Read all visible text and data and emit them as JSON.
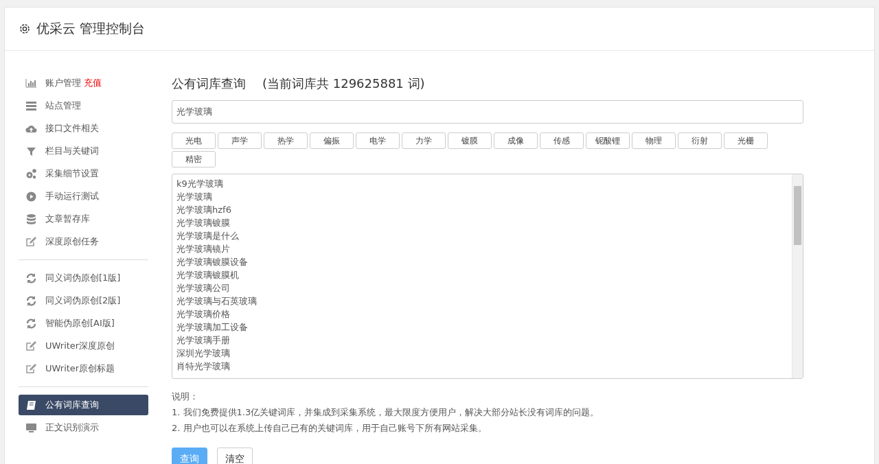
{
  "header": {
    "title": "优采云 管理控制台"
  },
  "sidebar": {
    "groups": [
      [
        {
          "kind": "chart",
          "label": "账户管理",
          "badge": "充值",
          "selected": false
        },
        {
          "kind": "server",
          "label": "站点管理",
          "selected": false
        },
        {
          "kind": "cloud",
          "label": "接口文件相关",
          "selected": false
        },
        {
          "kind": "filter",
          "label": "栏目与关键词",
          "selected": false
        },
        {
          "kind": "gears",
          "label": "采集细节设置",
          "selected": false
        },
        {
          "kind": "play",
          "label": "手动运行测试",
          "selected": false
        },
        {
          "kind": "database",
          "label": "文章暂存库",
          "selected": false
        },
        {
          "kind": "edit",
          "label": "深度原创任务",
          "selected": false
        }
      ],
      [
        {
          "kind": "refresh",
          "label": "同义词伪原创[1版]",
          "selected": false
        },
        {
          "kind": "refresh",
          "label": "同义词伪原创[2版]",
          "selected": false
        },
        {
          "kind": "refresh",
          "label": "智能伪原创[AI版]",
          "selected": false
        },
        {
          "kind": "edit",
          "label": "UWriter深度原创",
          "selected": false
        },
        {
          "kind": "edit",
          "label": "UWriter原创标题",
          "selected": false
        }
      ],
      [
        {
          "kind": "book",
          "label": "公有词库查询",
          "selected": true
        },
        {
          "kind": "monitor",
          "label": "正文识别演示",
          "selected": false
        }
      ]
    ]
  },
  "main": {
    "title": "公有词库查询",
    "count": "(当前词库共 129625881 词)",
    "search": {
      "value": "光学玻璃"
    },
    "tags": [
      "光电",
      "声学",
      "热学",
      "偏振",
      "电学",
      "力学",
      "镀膜",
      "成像",
      "传感",
      "铌酸锂",
      "物理",
      "衍射",
      "光栅",
      "精密"
    ],
    "results": [
      "k9光学玻璃",
      "光学玻璃",
      "光学玻璃hzf6",
      "光学玻璃镀膜",
      "光学玻璃是什么",
      "光学玻璃镜片",
      "光学玻璃镀膜设备",
      "光学玻璃镀膜机",
      "光学玻璃公司",
      "光学玻璃与石英玻璃",
      "光学玻璃价格",
      "光学玻璃加工设备",
      "光学玻璃手册",
      "深圳光学玻璃",
      "肖特光学玻璃"
    ],
    "notes": [
      "说明：",
      "1. 我们免费提供1.3亿关键词库，并集成到采集系统，最大限度方便用户，解决大部分站长没有词库的问题。",
      "2. 用户也可以在系统上传自己已有的关键词库，用于自己账号下所有网站采集。"
    ],
    "buttons": [
      {
        "kind": "primary",
        "label": "查询"
      },
      {
        "kind": "default",
        "label": "清空"
      }
    ]
  }
}
